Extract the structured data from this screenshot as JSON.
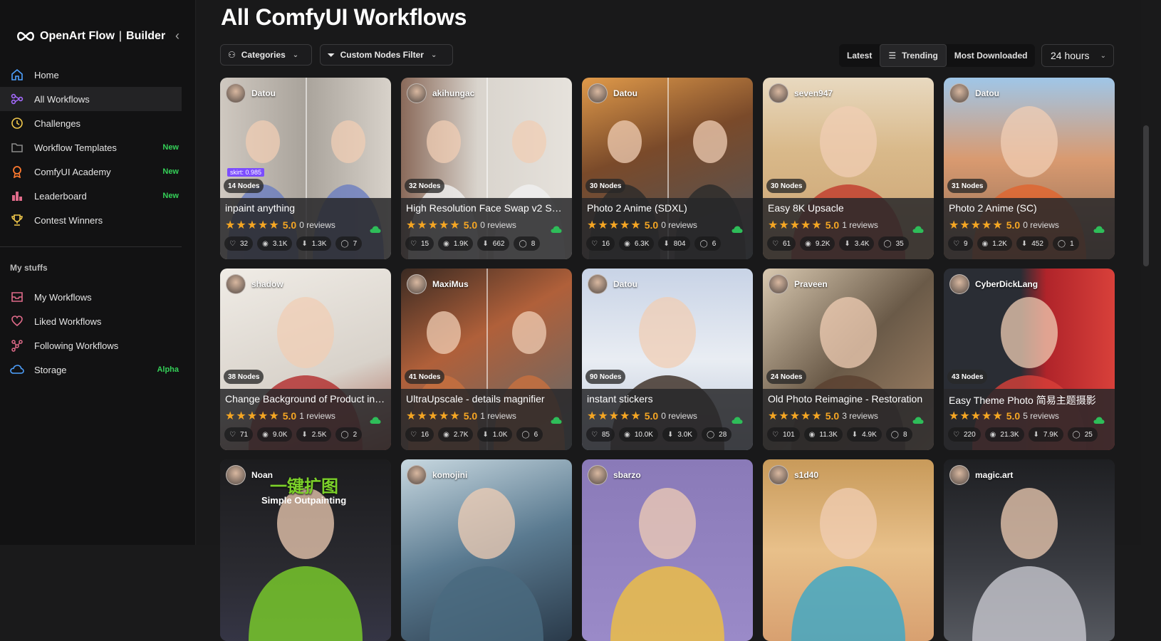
{
  "brand": {
    "name": "OpenArt Flow",
    "sub": "Builder"
  },
  "sidebar": {
    "items": [
      {
        "label": "Home",
        "icon": "home-icon",
        "tag": "",
        "color": "#4ea1ff"
      },
      {
        "label": "All Workflows",
        "icon": "workflow-icon",
        "tag": "",
        "color": "#a66bff"
      },
      {
        "label": "Challenges",
        "icon": "clock-icon",
        "tag": "",
        "color": "#f2c94c"
      },
      {
        "label": "Workflow Templates",
        "icon": "folder-icon",
        "tag": "New",
        "color": "#8a8a8a"
      },
      {
        "label": "ComfyUI Academy",
        "icon": "academy-icon",
        "tag": "New",
        "color": "#ff7a2f"
      },
      {
        "label": "Leaderboard",
        "icon": "leaderboard-icon",
        "tag": "New",
        "color": "#e06b8a"
      },
      {
        "label": "Contest Winners",
        "icon": "trophy-icon",
        "tag": "",
        "color": "#f2c94c"
      }
    ],
    "section_title": "My stuffs",
    "items2": [
      {
        "label": "My Workflows",
        "icon": "inbox-icon",
        "tag": "",
        "color": "#e06b8a"
      },
      {
        "label": "Liked Workflows",
        "icon": "heart-icon",
        "tag": "",
        "color": "#e06b8a"
      },
      {
        "label": "Following Workflows",
        "icon": "network-icon",
        "tag": "",
        "color": "#e06b8a"
      },
      {
        "label": "Storage",
        "icon": "cloud-icon",
        "tag": "Alpha",
        "color": "#4ea1ff"
      }
    ]
  },
  "main": {
    "title": "All ComfyUI Workflows",
    "filters": {
      "categories": "Categories",
      "custom_nodes": "Custom Nodes Filter"
    },
    "sort": {
      "latest": "Latest",
      "trending": "Trending",
      "most_downloaded": "Most Downloaded"
    },
    "time_range": "24 hours"
  },
  "cards": [
    {
      "author": "Datou",
      "nodes": "14 Nodes",
      "title": "inpaint anything",
      "score": "5.0",
      "reviews": "0 reviews",
      "likes": "32",
      "views": "3.1K",
      "downloads": "1.3K",
      "comments": "7",
      "bg": "linear-gradient(90deg,#cfc8c0 0%,#a9a39b 50%,#d8d2ca 100%)",
      "accent": "#6a7dc0",
      "split": true,
      "skirt": "skirt: 0.985"
    },
    {
      "author": "akihungac",
      "nodes": "32 Nodes",
      "title": "High Resolution Face Swap v2 SUPIR",
      "score": "5.0",
      "reviews": "0 reviews",
      "likes": "15",
      "views": "1.9K",
      "downloads": "662",
      "comments": "8",
      "bg": "linear-gradient(90deg,#8a6a5a 0%,#d9d4cd 45%,#e6e2dc 100%)",
      "accent": "#f0f0f0",
      "split": true,
      "skirt": ""
    },
    {
      "author": "Datou",
      "nodes": "30 Nodes",
      "title": "Photo 2 Anime (SDXL)",
      "score": "5.0",
      "reviews": "0 reviews",
      "likes": "16",
      "views": "6.3K",
      "downloads": "804",
      "comments": "6",
      "bg": "linear-gradient(160deg,#e09a4a 0%,#7a4a2a 40%,#4a5560 100%)",
      "accent": "#2a2a2a",
      "split": true,
      "skirt": ""
    },
    {
      "author": "seven947",
      "nodes": "30 Nodes",
      "title": "Easy 8K Upsacle",
      "score": "5.0",
      "reviews": "1 reviews",
      "likes": "61",
      "views": "9.2K",
      "downloads": "3.4K",
      "comments": "35",
      "bg": "linear-gradient(180deg,#e8d9c0 0%,#d9b98a 40%,#c9a070 100%)",
      "accent": "#c0392b",
      "split": false,
      "skirt": ""
    },
    {
      "author": "Datou",
      "nodes": "31 Nodes",
      "title": "Photo 2 Anime (SC)",
      "score": "5.0",
      "reviews": "0 reviews",
      "likes": "9",
      "views": "1.2K",
      "downloads": "452",
      "comments": "1",
      "bg": "linear-gradient(180deg,#9fc6e8 0%,#d99a70 45%,#8a6a55 100%)",
      "accent": "#e0642e",
      "split": false,
      "skirt": ""
    },
    {
      "author": "shadow",
      "nodes": "38 Nodes",
      "title": "Change Background of Product in Minutes",
      "score": "5.0",
      "reviews": "1 reviews",
      "likes": "71",
      "views": "9.0K",
      "downloads": "2.5K",
      "comments": "2",
      "bg": "linear-gradient(160deg,#f0ece6 0%,#d8d2ca 60%,#a85a4a 100%)",
      "accent": "#b22a2a",
      "split": false,
      "skirt": ""
    },
    {
      "author": "MaxiMus",
      "nodes": "41 Nodes",
      "title": "UltraUpscale - details magnifier",
      "score": "5.0",
      "reviews": "1 reviews",
      "likes": "16",
      "views": "2.7K",
      "downloads": "1.0K",
      "comments": "6",
      "bg": "linear-gradient(150deg,#3a2a22 0%,#b0603a 40%,#5a6a70 100%)",
      "accent": "#c8703e",
      "split": true,
      "skirt": ""
    },
    {
      "author": "Datou",
      "nodes": "90 Nodes",
      "title": "instant stickers",
      "score": "5.0",
      "reviews": "0 reviews",
      "likes": "85",
      "views": "10.0K",
      "downloads": "3.0K",
      "comments": "28",
      "bg": "linear-gradient(180deg,#c8d3e6 0%,#e9edf3 50%,#b9c4d8 100%)",
      "accent": "#3a2a20",
      "split": false,
      "skirt": ""
    },
    {
      "author": "Praveen",
      "nodes": "24 Nodes",
      "title": "Old Photo Reimagine - Restoration",
      "score": "5.0",
      "reviews": "3 reviews",
      "likes": "101",
      "views": "11.3K",
      "downloads": "4.9K",
      "comments": "8",
      "bg": "linear-gradient(135deg,#d8c8b0 0%,#6a5a48 50%,#a8886a 100%)",
      "accent": "#5a4030",
      "split": false,
      "skirt": ""
    },
    {
      "author": "CyberDickLang",
      "nodes": "43 Nodes",
      "title": "Easy Theme Photo 简易主题摄影",
      "score": "5.0",
      "reviews": "5 reviews",
      "likes": "220",
      "views": "21.3K",
      "downloads": "7.9K",
      "comments": "25",
      "bg": "linear-gradient(90deg,#2a2d34 0%,#2a2d34 45%,#b0242a 60%,#d8403a 100%)",
      "accent": "#d8403a",
      "split": false,
      "skirt": ""
    },
    {
      "author": "Noan",
      "nodes": "",
      "title": "",
      "score": "",
      "reviews": "",
      "likes": "",
      "views": "",
      "downloads": "",
      "comments": "",
      "bg": "linear-gradient(180deg,#1c1c1e 0%,#2a2a30 60%,#353545 100%)",
      "accent": "#7cd12a",
      "split": false,
      "skirt": "",
      "headline": "一键扩图",
      "subline": "Simple Outpainting"
    },
    {
      "author": "komojini",
      "nodes": "",
      "title": "",
      "score": "",
      "reviews": "",
      "likes": "",
      "views": "",
      "downloads": "",
      "comments": "",
      "bg": "linear-gradient(160deg,#c8d8e0 0%,#5a7a90 50%,#2a3a4a 100%)",
      "accent": "#4a6a80",
      "split": false,
      "skirt": ""
    },
    {
      "author": "sbarzo",
      "nodes": "",
      "title": "",
      "score": "",
      "reviews": "",
      "likes": "",
      "views": "",
      "downloads": "",
      "comments": "",
      "bg": "linear-gradient(180deg,#8a7ab8 0%,#9a8ac8 100%)",
      "accent": "#f0c040",
      "split": false,
      "skirt": ""
    },
    {
      "author": "s1d40",
      "nodes": "",
      "title": "",
      "score": "",
      "reviews": "",
      "likes": "",
      "views": "",
      "downloads": "",
      "comments": "",
      "bg": "linear-gradient(180deg,#c89a5a 0%,#e8c08a 50%,#d8a070 100%)",
      "accent": "#3aa8c8",
      "split": false,
      "skirt": ""
    },
    {
      "author": "magic.art",
      "nodes": "",
      "title": "",
      "score": "",
      "reviews": "",
      "likes": "",
      "views": "",
      "downloads": "",
      "comments": "",
      "bg": "linear-gradient(180deg,#1e1f22 0%,#3a3c42 60%,#55585f 100%)",
      "accent": "#c8c8d0",
      "split": false,
      "skirt": ""
    }
  ]
}
